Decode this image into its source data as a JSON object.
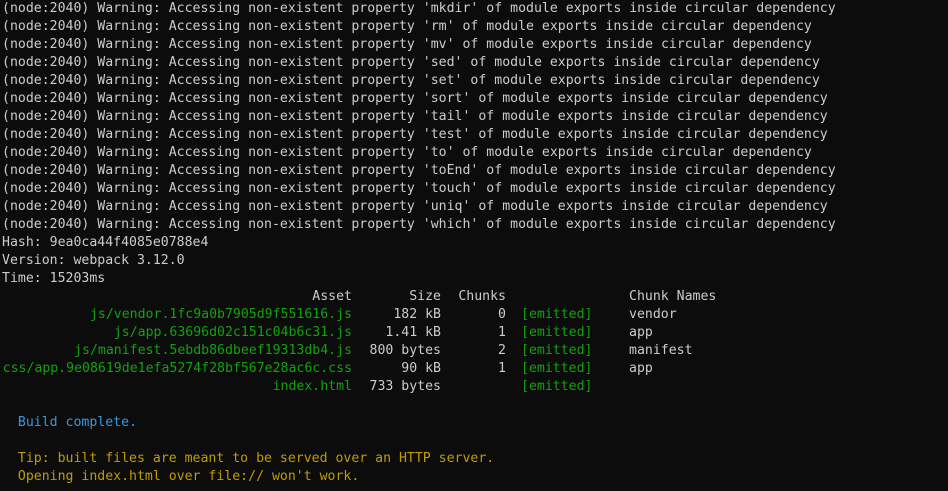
{
  "warnings": [
    "(node:2040) Warning: Accessing non-existent property 'mkdir' of module exports inside circular dependency",
    "(node:2040) Warning: Accessing non-existent property 'rm' of module exports inside circular dependency",
    "(node:2040) Warning: Accessing non-existent property 'mv' of module exports inside circular dependency",
    "(node:2040) Warning: Accessing non-existent property 'sed' of module exports inside circular dependency",
    "(node:2040) Warning: Accessing non-existent property 'set' of module exports inside circular dependency",
    "(node:2040) Warning: Accessing non-existent property 'sort' of module exports inside circular dependency",
    "(node:2040) Warning: Accessing non-existent property 'tail' of module exports inside circular dependency",
    "(node:2040) Warning: Accessing non-existent property 'test' of module exports inside circular dependency",
    "(node:2040) Warning: Accessing non-existent property 'to' of module exports inside circular dependency",
    "(node:2040) Warning: Accessing non-existent property 'toEnd' of module exports inside circular dependency",
    "(node:2040) Warning: Accessing non-existent property 'touch' of module exports inside circular dependency",
    "(node:2040) Warning: Accessing non-existent property 'uniq' of module exports inside circular dependency",
    "(node:2040) Warning: Accessing non-existent property 'which' of module exports inside circular dependency"
  ],
  "build_info": {
    "hash": "Hash: 9ea0ca44f4085e0788e4",
    "version": "Version: webpack 3.12.0",
    "time": "Time: 15203ms"
  },
  "assets_table": {
    "headers": {
      "asset": "Asset",
      "size": "Size",
      "chunks": "Chunks",
      "chunk_names": "Chunk Names"
    },
    "rows": [
      {
        "asset": "js/vendor.1fc9a0b7905d9f551616.js",
        "size": "182 kB",
        "chunks": "0",
        "status": "[emitted]",
        "chunk_names": "vendor"
      },
      {
        "asset": "js/app.63696d02c151c04b6c31.js",
        "size": "1.41 kB",
        "chunks": "1",
        "status": "[emitted]",
        "chunk_names": "app"
      },
      {
        "asset": "js/manifest.5ebdb86dbeef19313db4.js",
        "size": "800 bytes",
        "chunks": "2",
        "status": "[emitted]",
        "chunk_names": "manifest"
      },
      {
        "asset": "css/app.9e08619de1efa5274f28bf567e28ac6c.css",
        "size": "90 kB",
        "chunks": "1",
        "status": "[emitted]",
        "chunk_names": "app"
      },
      {
        "asset": "index.html",
        "size": "733 bytes",
        "chunks": "",
        "status": "[emitted]",
        "chunk_names": ""
      }
    ]
  },
  "messages": {
    "build_complete": "  Build complete.",
    "tip_line1": "  Tip: built files are meant to be served over an HTTP server.",
    "tip_line2": "  Opening index.html over file:// won't work."
  },
  "colors": {
    "background": "#0c0c0c",
    "text": "#cccccc",
    "green": "#13a10e",
    "blue": "#3a96dd",
    "yellow": "#c19c00"
  }
}
